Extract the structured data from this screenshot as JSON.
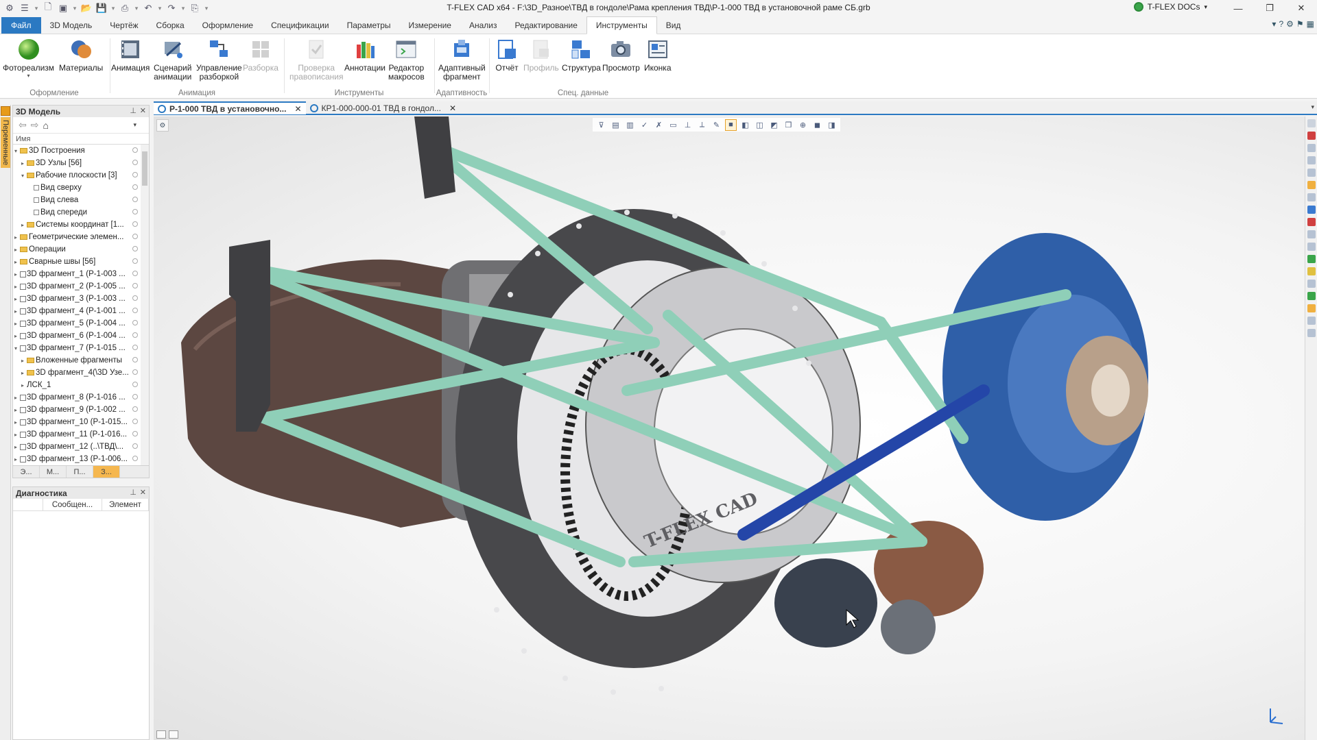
{
  "titlebar": {
    "title": "T-FLEX CAD x64 - F:\\3D_Разное\\ТВД в гондоле\\Рама крепления ТВД\\Р-1-000 ТВД в установочной раме СБ.grb",
    "docs_label": "T-FLEX DOCs",
    "win_min": "—",
    "win_restore": "❐",
    "win_close": "✕"
  },
  "ribbon_tabs": [
    {
      "label": "Файл"
    },
    {
      "label": "3D Модель"
    },
    {
      "label": "Чертёж"
    },
    {
      "label": "Сборка"
    },
    {
      "label": "Оформление"
    },
    {
      "label": "Спецификации"
    },
    {
      "label": "Параметры"
    },
    {
      "label": "Измерение"
    },
    {
      "label": "Анализ"
    },
    {
      "label": "Редактирование"
    },
    {
      "label": "Инструменты"
    },
    {
      "label": "Вид"
    }
  ],
  "ribbon": {
    "groups": {
      "oformlenie": "Оформление",
      "animation": "Анимация",
      "instruments": "Инструменты",
      "adaptivity": "Адаптивность",
      "spec_data": "Спец. данные"
    },
    "buttons": {
      "photorealism": "Фотореализм",
      "materials": "Материалы",
      "animation": "Анимация",
      "scenarios_1": "Сценарий",
      "scenarios_2": "анимации",
      "explode_mgmt_1": "Управление",
      "explode_mgmt_2": "разборкой",
      "explode": "Разборка",
      "spellcheck_1": "Проверка",
      "spellcheck_2": "правописания",
      "annotations": "Аннотации",
      "macro_editor_1": "Редактор",
      "macro_editor_2": "макросов",
      "adaptive_1": "Адаптивный",
      "adaptive_2": "фрагмент",
      "report": "Отчёт",
      "profile": "Профиль",
      "structure": "Структура",
      "view": "Просмотр",
      "icon": "Иконка"
    }
  },
  "side_tab": {
    "label": "Переменные"
  },
  "model_panel": {
    "title": "3D Модель",
    "column_name": "Имя",
    "tree": [
      {
        "label": "3D Построения",
        "indent": 0,
        "icon": "folder",
        "toggle": "▾"
      },
      {
        "label": "3D Узлы [56]",
        "indent": 1,
        "icon": "folder",
        "toggle": "▸"
      },
      {
        "label": "Рабочие плоскости [3]",
        "indent": 1,
        "icon": "folder",
        "toggle": "▾"
      },
      {
        "label": "Вид сверху",
        "indent": 2,
        "icon": "plane",
        "toggle": ""
      },
      {
        "label": "Вид слева",
        "indent": 2,
        "icon": "plane",
        "toggle": ""
      },
      {
        "label": "Вид спереди",
        "indent": 2,
        "icon": "plane",
        "toggle": ""
      },
      {
        "label": "Системы координат [1...",
        "indent": 1,
        "icon": "folder",
        "toggle": "▸"
      },
      {
        "label": "Геометрические элемен...",
        "indent": 0,
        "icon": "folder",
        "toggle": "▸"
      },
      {
        "label": "Операции",
        "indent": 0,
        "icon": "folder",
        "toggle": "▸"
      },
      {
        "label": "Сварные швы [56]",
        "indent": 0,
        "icon": "folder",
        "toggle": "▸"
      },
      {
        "label": "3D фрагмент_1 (Р-1-003 ...",
        "indent": 0,
        "icon": "frag",
        "toggle": "▸"
      },
      {
        "label": "3D фрагмент_2 (Р-1-005 ...",
        "indent": 0,
        "icon": "frag",
        "toggle": "▸"
      },
      {
        "label": "3D фрагмент_3 (Р-1-003 ...",
        "indent": 0,
        "icon": "frag",
        "toggle": "▸"
      },
      {
        "label": "3D фрагмент_4 (Р-1-001 ...",
        "indent": 0,
        "icon": "frag",
        "toggle": "▸"
      },
      {
        "label": "3D фрагмент_5 (Р-1-004 ...",
        "indent": 0,
        "icon": "frag",
        "toggle": "▸"
      },
      {
        "label": "3D фрагмент_6 (Р-1-004 ...",
        "indent": 0,
        "icon": "frag",
        "toggle": "▸"
      },
      {
        "label": "3D фрагмент_7 (Р-1-015 ...",
        "indent": 0,
        "icon": "frag",
        "toggle": "▾"
      },
      {
        "label": "Вложенные фрагменты",
        "indent": 1,
        "icon": "folder",
        "toggle": "▸"
      },
      {
        "label": "3D фрагмент_4(\\3D Узе...",
        "indent": 1,
        "icon": "folder",
        "toggle": "▸"
      },
      {
        "label": "ЛСК_1",
        "indent": 1,
        "icon": "none",
        "toggle": "▸"
      },
      {
        "label": "3D фрагмент_8 (Р-1-016 ...",
        "indent": 0,
        "icon": "frag",
        "toggle": "▸"
      },
      {
        "label": "3D фрагмент_9 (Р-1-002 ...",
        "indent": 0,
        "icon": "frag",
        "toggle": "▸"
      },
      {
        "label": "3D фрагмент_10 (Р-1-015...",
        "indent": 0,
        "icon": "frag",
        "toggle": "▸"
      },
      {
        "label": "3D фрагмент_11 (Р-1-016...",
        "indent": 0,
        "icon": "frag",
        "toggle": "▸"
      },
      {
        "label": "3D фрагмент_12 (..\\ТВД\\...",
        "indent": 0,
        "icon": "frag",
        "toggle": "▸"
      },
      {
        "label": "3D фрагмент_13 (Р-1-006...",
        "indent": 0,
        "icon": "frag",
        "toggle": "▸"
      }
    ],
    "bottom_tabs": [
      "Э...",
      "М...",
      "П...",
      "З..."
    ]
  },
  "diag_panel": {
    "title": "Диагностика",
    "col_message": "Сообщен...",
    "col_element": "Элемент"
  },
  "doc_tabs": [
    {
      "label": "Р-1-000 ТВД в установочно...",
      "active": true
    },
    {
      "label": "КР1-000-000-01 ТВД в гондол...",
      "active": false
    }
  ],
  "viewport": {
    "model_watermark": "T-FLEX CAD"
  },
  "colors": {
    "accent": "#2b79c2",
    "frame_green": "#8fcfb8",
    "housing_blue": "#2f5fa8",
    "plate_dark": "#4a4a4c",
    "duct_brown": "#5c4741"
  }
}
